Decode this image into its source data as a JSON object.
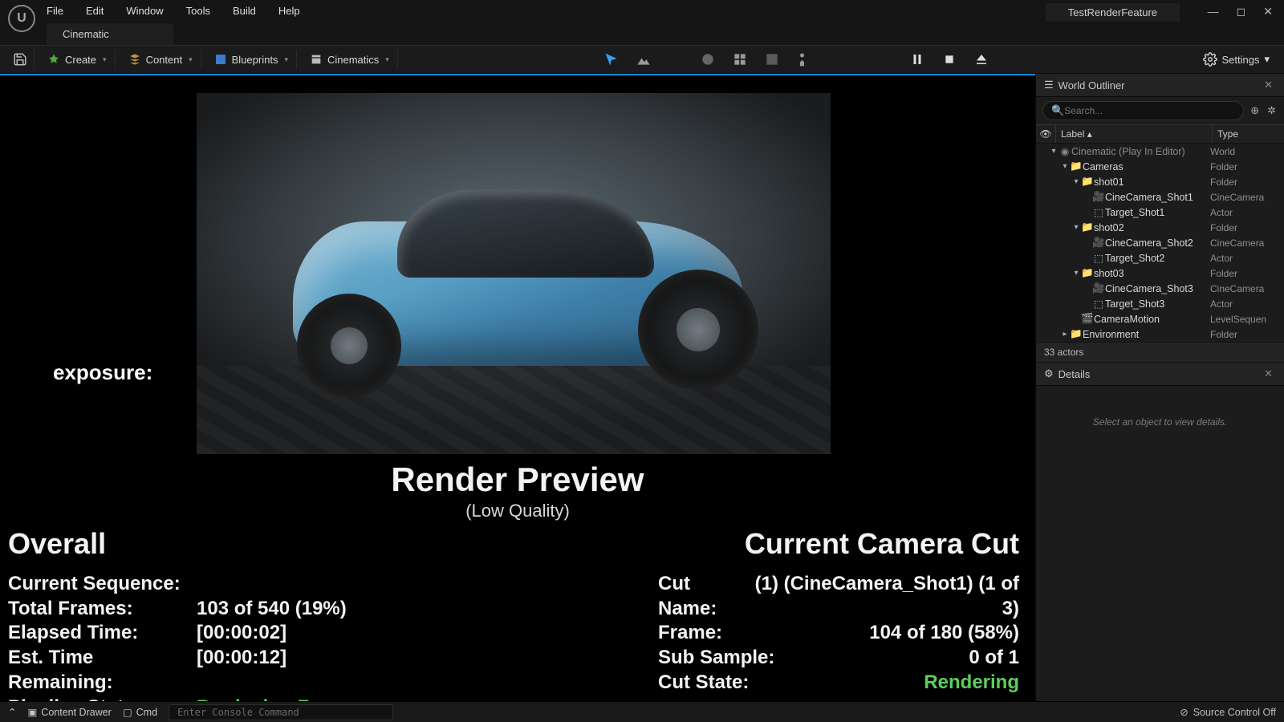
{
  "menubar": [
    "File",
    "Edit",
    "Window",
    "Tools",
    "Build",
    "Help"
  ],
  "project_label": "TestRenderFeature",
  "level_tab": "Cinematic",
  "toolbar": {
    "save": "",
    "create": "Create",
    "content": "Content",
    "blueprints": "Blueprints",
    "cinematics": "Cinematics",
    "settings": "Settings"
  },
  "viewport": {
    "exposure_label": "exposure:",
    "preview_title": "Render Preview",
    "preview_sub": "(Low Quality)",
    "left": {
      "heading": "Overall",
      "rows": [
        {
          "label": "Current Sequence:",
          "value": ""
        },
        {
          "label": "Total Frames:",
          "value": "103 of 540 (19%)"
        },
        {
          "label": "Elapsed Time:",
          "value": "[00:00:02]"
        },
        {
          "label": "Est. Time Remaining:",
          "value": "[00:00:12]"
        },
        {
          "label": "Pipeline State:",
          "value": "Producing Frames",
          "green": true
        }
      ]
    },
    "right": {
      "heading": "Current Camera Cut",
      "rows": [
        {
          "label": "Cut Name:",
          "value": "(1) (CineCamera_Shot1) (1 of 3)"
        },
        {
          "label": "Frame:",
          "value": "104 of 180 (58%)"
        },
        {
          "label": "Sub Sample:",
          "value": "0 of 1"
        },
        {
          "label": "Cut State:",
          "value": "Rendering",
          "green": true
        }
      ]
    }
  },
  "outliner": {
    "title": "World Outliner",
    "search_placeholder": "Search...",
    "col_label": "Label",
    "col_type": "Type",
    "rows": [
      {
        "depth": 0,
        "exp": "▾",
        "icon": "world",
        "name": "Cinematic (Play In Editor)",
        "dim": true,
        "type": "World"
      },
      {
        "depth": 1,
        "exp": "▾",
        "icon": "folder",
        "name": "Cameras",
        "type": "Folder"
      },
      {
        "depth": 2,
        "exp": "▾",
        "icon": "folder",
        "name": "shot01",
        "type": "Folder"
      },
      {
        "depth": 3,
        "exp": "",
        "icon": "cam",
        "name": "CineCamera_Shot1",
        "type": "CineCamera"
      },
      {
        "depth": 3,
        "exp": "",
        "icon": "actor",
        "name": "Target_Shot1",
        "type": "Actor"
      },
      {
        "depth": 2,
        "exp": "▾",
        "icon": "folder",
        "name": "shot02",
        "type": "Folder"
      },
      {
        "depth": 3,
        "exp": "",
        "icon": "cam",
        "name": "CineCamera_Shot2",
        "type": "CineCamera"
      },
      {
        "depth": 3,
        "exp": "",
        "icon": "actor",
        "name": "Target_Shot2",
        "type": "Actor"
      },
      {
        "depth": 2,
        "exp": "▾",
        "icon": "folder",
        "name": "shot03",
        "type": "Folder"
      },
      {
        "depth": 3,
        "exp": "",
        "icon": "cam",
        "name": "CineCamera_Shot3",
        "type": "CineCamera"
      },
      {
        "depth": 3,
        "exp": "",
        "icon": "actor",
        "name": "Target_Shot3",
        "type": "Actor"
      },
      {
        "depth": 2,
        "exp": "",
        "icon": "seq",
        "name": "CameraMotion",
        "type": "LevelSequen"
      },
      {
        "depth": 1,
        "exp": "▸",
        "icon": "folder",
        "name": "Environment",
        "type": "Folder"
      }
    ],
    "actor_count": "33 actors"
  },
  "details": {
    "title": "Details",
    "empty": "Select an object to view details."
  },
  "statusbar": {
    "content_drawer": "Content Drawer",
    "cmd": "Cmd",
    "console_placeholder": "Enter Console Command",
    "source_control": "Source Control Off"
  }
}
